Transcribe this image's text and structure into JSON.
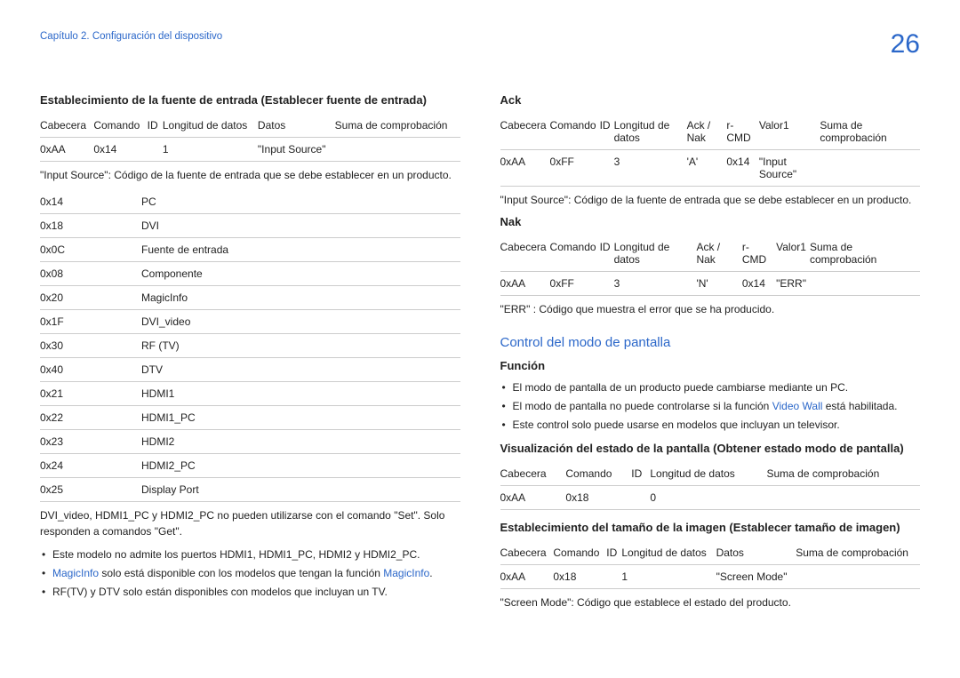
{
  "header": {
    "chapter": "Capítulo 2. Configuración del dispositivo",
    "page": "26"
  },
  "left": {
    "title1": "Establecimiento de la fuente de entrada (Establecer fuente de entrada)",
    "table1_headers": [
      "Cabecera",
      "Comando",
      "ID",
      "Longitud de datos",
      "Datos",
      "Suma de comprobación"
    ],
    "table1_row": [
      "0xAA",
      "0x14",
      "",
      "1",
      "\"Input Source\"",
      ""
    ],
    "note1": "\"Input Source\": Código de la fuente de entrada que se debe establecer en un producto.",
    "sources": [
      [
        "0x14",
        "PC"
      ],
      [
        "0x18",
        "DVI"
      ],
      [
        "0x0C",
        "Fuente de entrada"
      ],
      [
        "0x08",
        "Componente"
      ],
      [
        "0x20",
        "MagicInfo"
      ],
      [
        "0x1F",
        "DVI_video"
      ],
      [
        "0x30",
        "RF (TV)"
      ],
      [
        "0x40",
        "DTV"
      ],
      [
        "0x21",
        "HDMI1"
      ],
      [
        "0x22",
        "HDMI1_PC"
      ],
      [
        "0x23",
        "HDMI2"
      ],
      [
        "0x24",
        "HDMI2_PC"
      ],
      [
        "0x25",
        "Display Port"
      ]
    ],
    "note2": "DVI_video, HDMI1_PC y HDMI2_PC no pueden utilizarse con el comando \"Set\". Solo responden a comandos \"Get\".",
    "bullets": {
      "b1": "Este modelo no admite los puertos HDMI1, HDMI1_PC, HDMI2 y HDMI2_PC.",
      "b2a": "MagicInfo",
      "b2b": " solo está disponible con los modelos que tengan la función ",
      "b2c": "MagicInfo",
      "b2d": ".",
      "b3": "RF(TV) y DTV solo están disponibles con modelos que incluyan un TV."
    }
  },
  "right": {
    "ack_title": "Ack",
    "ack_headers": [
      "Cabecera",
      "Comando",
      "ID",
      "Longitud de datos",
      "Ack / Nak",
      "r-CMD",
      "Valor1",
      "Suma de comprobación"
    ],
    "ack_row": [
      "0xAA",
      "0xFF",
      "",
      "3",
      "'A'",
      "0x14",
      "\"Input Source\"",
      ""
    ],
    "ack_note": "\"Input Source\": Código de la fuente de entrada que se debe establecer en un producto.",
    "nak_title": "Nak",
    "nak_headers": [
      "Cabecera",
      "Comando",
      "ID",
      "Longitud de datos",
      "Ack / Nak",
      "r-CMD",
      "Valor1",
      "Suma de comprobación"
    ],
    "nak_row": [
      "0xAA",
      "0xFF",
      "",
      "3",
      "'N'",
      "0x14",
      "\"ERR\"",
      ""
    ],
    "nak_note": "\"ERR\" : Código que muestra el error que se ha producido.",
    "section2": "Control del modo de pantalla",
    "funcion_label": "Función",
    "funcion_bullets": {
      "f1": "El modo de pantalla de un producto puede cambiarse mediante un PC.",
      "f2a": "El modo de pantalla no puede controlarse si la función ",
      "f2b": "Video Wall",
      "f2c": " está habilitada.",
      "f3": "Este control solo puede usarse en modelos que incluyan un televisor."
    },
    "vis_title": "Visualización del estado de la pantalla (Obtener estado modo de pantalla)",
    "vis_headers": [
      "Cabecera",
      "Comando",
      "ID",
      "Longitud de datos",
      "Suma de comprobación"
    ],
    "vis_row": [
      "0xAA",
      "0x18",
      "",
      "0",
      ""
    ],
    "est_title": "Establecimiento del tamaño de la imagen (Establecer tamaño de imagen)",
    "est_headers": [
      "Cabecera",
      "Comando",
      "ID",
      "Longitud de datos",
      "Datos",
      "Suma de comprobación"
    ],
    "est_row": [
      "0xAA",
      "0x18",
      "",
      "1",
      "\"Screen Mode\"",
      ""
    ],
    "est_note": "\"Screen Mode\": Código que establece el estado del producto."
  }
}
